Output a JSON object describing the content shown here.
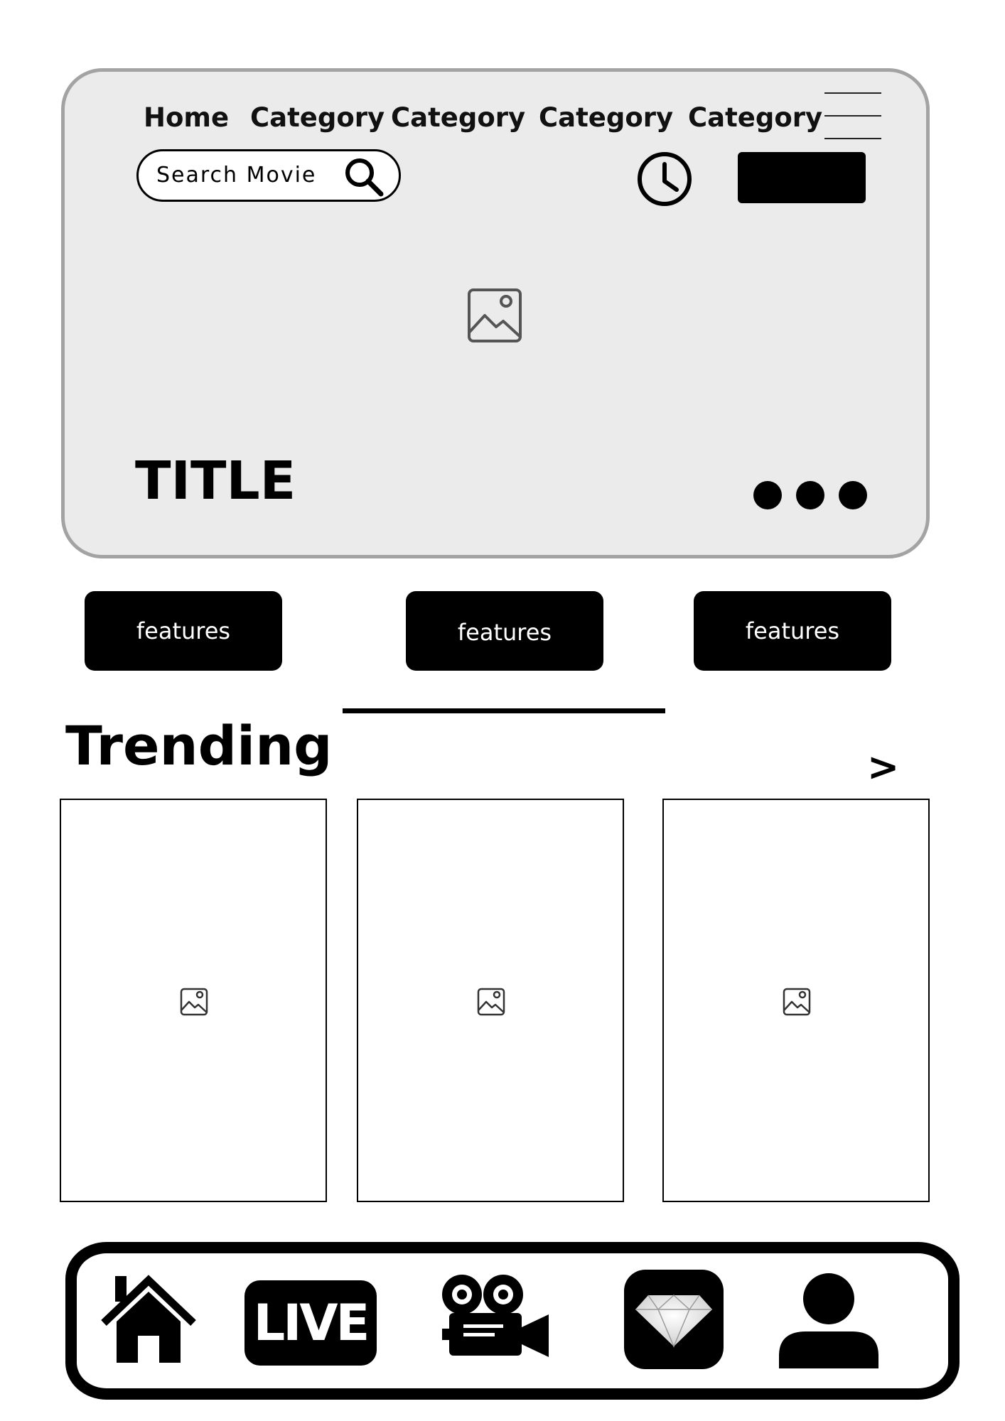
{
  "nav": {
    "items": [
      "Home",
      "Category",
      "Category",
      "Category",
      "Category"
    ]
  },
  "search": {
    "placeholder": "Search Movie"
  },
  "hero": {
    "title": "TITLE"
  },
  "features": {
    "buttons": [
      "features",
      "features",
      "features"
    ]
  },
  "trending": {
    "heading": "Trending",
    "more_label": ">"
  },
  "bottom_nav": {
    "live_label": "LIVE",
    "icons": [
      "home-icon",
      "live-icon",
      "movie-camera-icon",
      "diamond-icon",
      "profile-icon"
    ]
  },
  "colors": {
    "hero_bg": "#ebebeb",
    "hero_border": "#a3a3a3",
    "button_bg": "#000000",
    "button_text": "#ffffff"
  }
}
